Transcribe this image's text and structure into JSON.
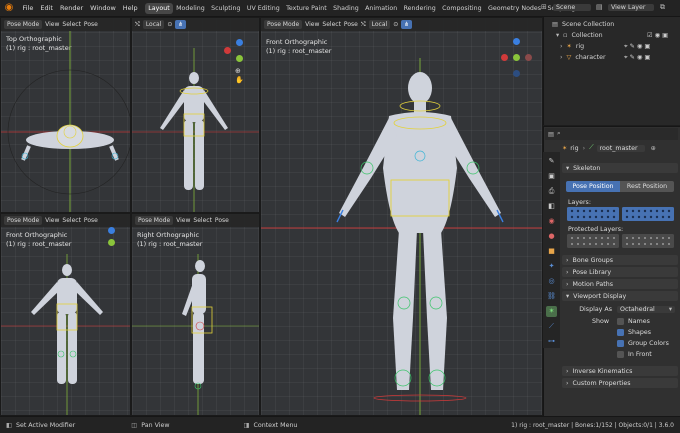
{
  "topbar": {
    "menu": [
      "File",
      "Edit",
      "Render",
      "Window",
      "Help"
    ],
    "workspaces": [
      "Layout",
      "Modeling",
      "Sculpting",
      "UV Editing",
      "Texture Paint",
      "Shading",
      "Animation",
      "Rendering",
      "Compositing",
      "Geometry Nodes",
      "Scripting"
    ],
    "active_workspace": "Layout",
    "scene": "Scene",
    "view_layer": "View Layer"
  },
  "viewport_header": {
    "mode": "Pose Mode",
    "view": "View",
    "select": "Select",
    "pose": "Pose",
    "orientation": "Local"
  },
  "viewports": {
    "top": {
      "title": "Top Orthographic",
      "subtitle": "(1) rig : root_master"
    },
    "front_small": {
      "title": "Front Orthographic",
      "subtitle": "(1) rig : root_master"
    },
    "right": {
      "title": "Right Orthographic",
      "subtitle": "(1) rig : root_master"
    },
    "front_main": {
      "title": "Front Orthographic",
      "subtitle": "(1) rig : root_master"
    }
  },
  "outliner": {
    "root": "Scene Collection",
    "collection": "Collection",
    "items": [
      "rig",
      "character"
    ]
  },
  "properties": {
    "breadcrumb_object": "rig",
    "breadcrumb_bone": "root_master",
    "skeleton_label": "Skeleton",
    "pose_position": "Pose Position",
    "rest_position": "Rest Position",
    "layers_label": "Layers:",
    "protected_layers_label": "Protected Layers:",
    "sections": [
      "Bone Groups",
      "Pose Library",
      "Motion Paths"
    ],
    "viewport_display": "Viewport Display",
    "display_as_label": "Display As",
    "display_as_value": "Octahedral",
    "show_label": "Show",
    "show_options": [
      "Names",
      "Shapes",
      "Group Colors",
      "In Front"
    ],
    "bottom_sections": [
      "Inverse Kinematics",
      "Custom Properties"
    ]
  },
  "statusbar": {
    "left": "Set Active Modifier",
    "middle": "Pan View",
    "right_hint": "Context Menu",
    "info": "1) rig : root_master | Bones:1/152 | Objects:0/1 | 3.6.0"
  },
  "colors": {
    "accent": "#4772b3",
    "x_axis": "#d03a3a",
    "y_axis": "#8ac43b",
    "bone_yellow": "#e3d23a",
    "blender_orange": "#e87d0d"
  }
}
